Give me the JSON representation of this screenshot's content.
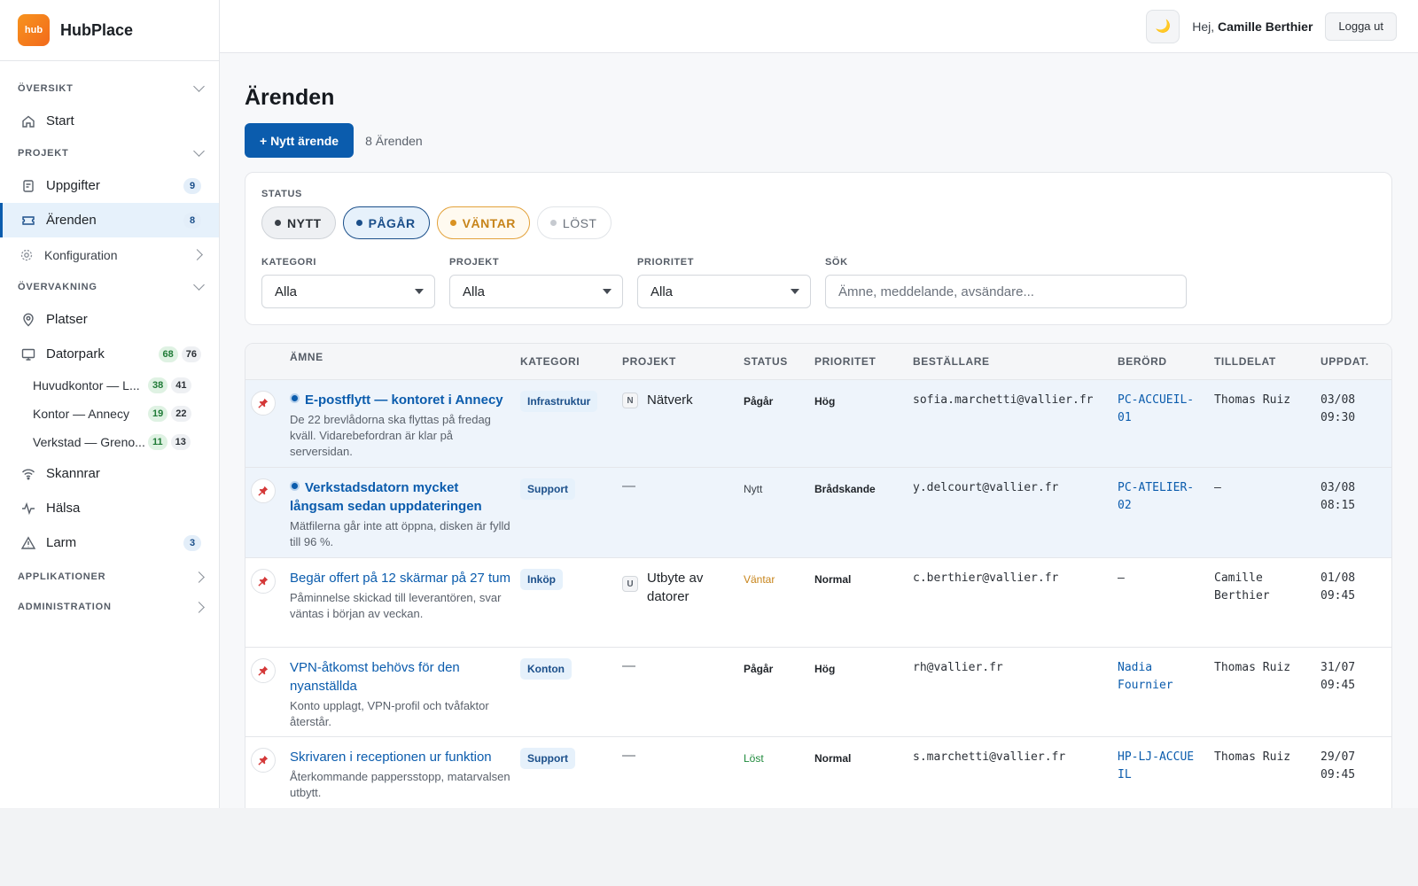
{
  "brand": {
    "logo_text": "hub",
    "name": "HubPlace"
  },
  "sidebar": {
    "sections": {
      "oversikt": "ÖVERSIKT",
      "projekt": "PROJEKT",
      "overvakning": "ÖVERVAKNING",
      "applikationer": "APPLIKATIONER",
      "administration": "ADMINISTRATION"
    },
    "items": {
      "start": "Start",
      "uppgifter": {
        "label": "Uppgifter",
        "badge": "9"
      },
      "arenden": {
        "label": "Ärenden",
        "badge": "8"
      },
      "konfiguration": "Konfiguration",
      "platser": "Platser",
      "datorpark": {
        "label": "Datorpark",
        "badge_ok": "68",
        "badge_total": "76"
      },
      "skannrar": "Skannrar",
      "halsa": "Hälsa",
      "larm": {
        "label": "Larm",
        "badge": "3"
      }
    },
    "sites": [
      {
        "label": "Huvudkontor — L...",
        "ok": "38",
        "total": "41"
      },
      {
        "label": "Kontor — Annecy",
        "ok": "19",
        "total": "22"
      },
      {
        "label": "Verkstad — Greno...",
        "ok": "11",
        "total": "13"
      }
    ]
  },
  "topbar": {
    "theme_icon": "🌙",
    "greeting": "Hej,",
    "user_name": "Camille Berthier",
    "logout": "Logga ut"
  },
  "page": {
    "title": "Ärenden",
    "new_button": "+ Nytt ärende",
    "count": "8 Ärenden"
  },
  "filters": {
    "status_label": "STATUS",
    "statuses": {
      "nytt": "NYTT",
      "pagar": "PÅGÅR",
      "vantar": "VÄNTAR",
      "lost": "LÖST"
    },
    "kategori": {
      "label": "KATEGORI",
      "value": "Alla"
    },
    "projekt": {
      "label": "PROJEKT",
      "value": "Alla"
    },
    "prioritet": {
      "label": "PRIORITET",
      "value": "Alla"
    },
    "sok": {
      "label": "SÖK",
      "placeholder": "Ämne, meddelande, avsändare..."
    }
  },
  "table": {
    "headers": {
      "amne": "ÄMNE",
      "kategori": "KATEGORI",
      "projekt": "PROJEKT",
      "status": "STATUS",
      "prioritet": "PRIORITET",
      "bestallare": "BESTÄLLARE",
      "berord": "BERÖRD",
      "tilldelat": "TILLDELAT",
      "uppdat": "UPPDAT."
    },
    "rows": [
      {
        "title": "E-postflytt — kontoret i Annecy",
        "desc": "De 22 brevlådorna ska flyttas på fredag kväll. Vidarebefordran är klar på serversidan.",
        "kategori": "Infrastruktur",
        "proj_code": "N",
        "projekt": "Nätverk",
        "status": "Pågår",
        "prioritet": "Hög",
        "bestallare": "sofia.marchetti@vallier.fr",
        "berord": "PC-ACCUEIL-01",
        "tilldelat": "Thomas Ruiz",
        "date": "03/08",
        "time": "09:30"
      },
      {
        "title": "Verkstadsdatorn mycket långsam sedan uppdateringen",
        "desc": "Mätfilerna går inte att öppna, disken är fylld till 96 %.",
        "kategori": "Support",
        "projekt": "—",
        "status": "Nytt",
        "prioritet": "Brådskande",
        "bestallare": "y.delcourt@vallier.fr",
        "berord": "PC-ATELIER-02",
        "tilldelat": "—",
        "date": "03/08",
        "time": "08:15"
      },
      {
        "title": "Begär offert på 12 skärmar på 27 tum",
        "desc": "Påminnelse skickad till leverantören, svar väntas i början av veckan.",
        "kategori": "Inköp",
        "proj_code": "U",
        "projekt": "Utbyte av datorer",
        "status": "Väntar",
        "prioritet": "Normal",
        "bestallare": "c.berthier@vallier.fr",
        "berord": "—",
        "tilldelat": "Camille Berthier",
        "date": "01/08",
        "time": "09:45"
      },
      {
        "title": "VPN-åtkomst behövs för den nyanställda",
        "desc": "Konto upplagt, VPN-profil och tvåfaktor återstår.",
        "kategori": "Konton",
        "projekt": "—",
        "status": "Pågår",
        "prioritet": "Hög",
        "bestallare": "rh@vallier.fr",
        "berord": "Nadia Fournier",
        "tilldelat": "Thomas Ruiz",
        "date": "31/07",
        "time": "09:45"
      },
      {
        "title": "Skrivaren i receptionen ur funktion",
        "desc": "Återkommande pappersstopp, matarvalsen utbytt.",
        "kategori": "Support",
        "projekt": "—",
        "status": "Löst",
        "prioritet": "Normal",
        "bestallare": "s.marchetti@vallier.fr",
        "berord": "HP-LJ-ACCUEIL",
        "tilldelat": "Thomas Ruiz",
        "date": "29/07",
        "time": "09:45"
      }
    ]
  },
  "colors": {
    "accent": "#0b5cad",
    "brand_orange": "#f26a1b",
    "waiting": "#c7841a",
    "resolved": "#1f8a3c"
  },
  "icons": [
    "home-icon",
    "tasks-icon",
    "ticket-icon",
    "gear-icon",
    "location-icon",
    "monitor-icon",
    "wifi-icon",
    "pulse-icon",
    "alert-icon",
    "moon-icon",
    "pin-icon"
  ]
}
